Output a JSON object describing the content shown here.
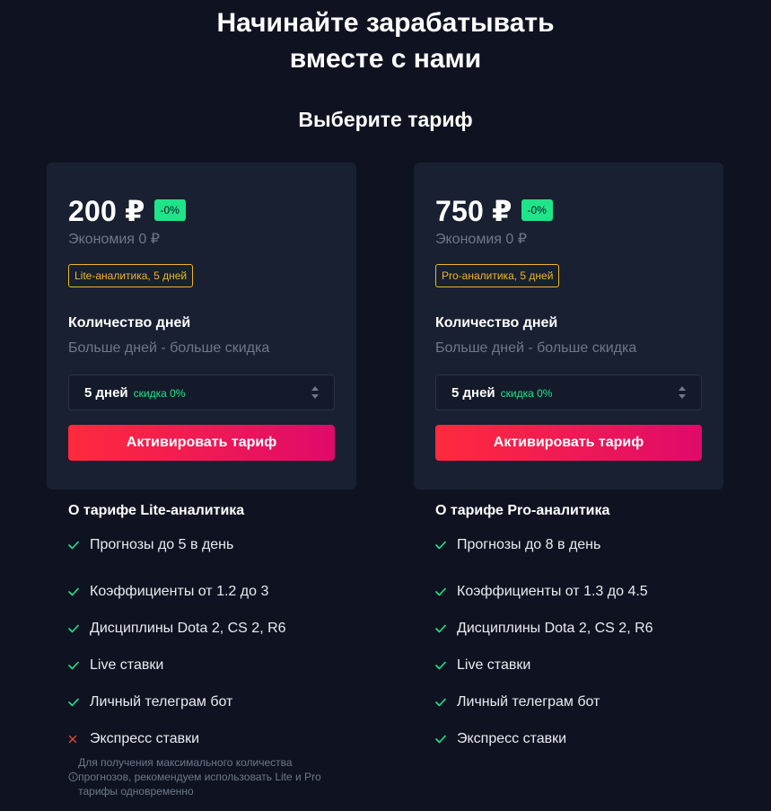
{
  "hero": {
    "line1": "Начинайте зарабатывать",
    "line2": "вместе с нами",
    "subtitle": "Выберите тариф"
  },
  "plans": [
    {
      "price": "200 ₽",
      "discount_badge": "-0%",
      "savings": "Экономия 0 ₽",
      "tag": "Lite-аналитика, 5 дней",
      "days_title": "Количество дней",
      "days_hint": "Больше дней - больше скидка",
      "days_selected": "5 дней",
      "days_discount": "скидка 0%",
      "button": "Активировать тариф",
      "about_title": "О тарифе Lite-аналитика",
      "features": [
        {
          "text": "Прогнозы до 5 в день",
          "included": true
        },
        {
          "text": "Коэффициенты от 1.2 до 3",
          "included": true
        },
        {
          "text": "Дисциплины Dota 2, CS 2, R6",
          "included": true
        },
        {
          "text": "Live ставки",
          "included": true
        },
        {
          "text": "Личный телеграм бот",
          "included": true
        },
        {
          "text": "Экспресс ставки",
          "included": false
        }
      ]
    },
    {
      "price": "750 ₽",
      "discount_badge": "-0%",
      "savings": "Экономия 0 ₽",
      "tag": "Pro-аналитика, 5 дней",
      "days_title": "Количество дней",
      "days_hint": "Больше дней - больше скидка",
      "days_selected": "5 дней",
      "days_discount": "скидка 0%",
      "button": "Активировать тариф",
      "about_title": "О тарифе Pro-аналитика",
      "features": [
        {
          "text": "Прогнозы до 8 в день",
          "included": true
        },
        {
          "text": "Коэффициенты от 1.3 до 4.5",
          "included": true
        },
        {
          "text": "Дисциплины Dota 2, CS 2, R6",
          "included": true
        },
        {
          "text": "Live ставки",
          "included": true
        },
        {
          "text": "Личный телеграм бот",
          "included": true
        },
        {
          "text": "Экспресс ставки",
          "included": true
        }
      ]
    }
  ],
  "info_note": "Для получения максимального количества прогнозов, рекомендуем использовать Lite и Pro тарифы одновременно",
  "colors": {
    "background": "#0f1321",
    "card": "#182031",
    "accent_green": "#1fe58a",
    "tag_yellow": "#f0b429",
    "button_start": "#ff2a3d",
    "button_end": "#e00a6b",
    "cross_red": "#e0433b"
  }
}
